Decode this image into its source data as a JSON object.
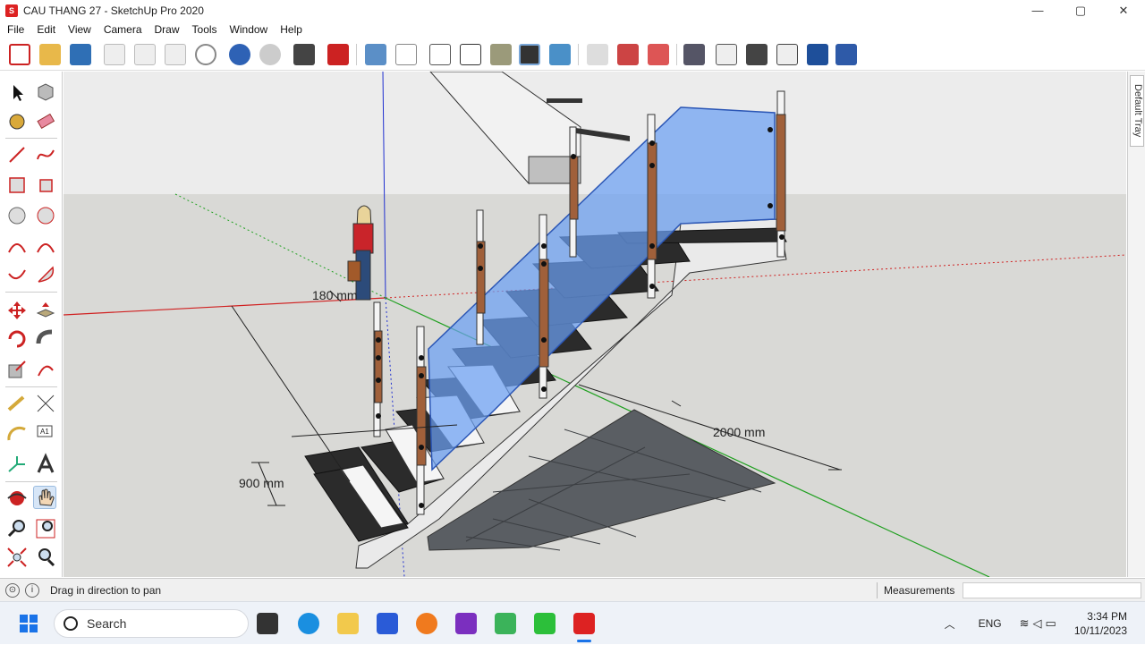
{
  "window": {
    "title": "CAU THANG 27 - SketchUp Pro 2020",
    "minimize": "—",
    "maximize": "▢",
    "close": "✕"
  },
  "menu": [
    "File",
    "Edit",
    "View",
    "Camera",
    "Draw",
    "Tools",
    "Window",
    "Help"
  ],
  "tray": {
    "label": "Default Tray"
  },
  "viewport": {
    "dimensions": {
      "width_label": "900 mm",
      "length_label": "2000 mm",
      "height_label": "180 mm"
    }
  },
  "status": {
    "message": "Drag in direction to pan",
    "measurements_label": "Measurements",
    "measurements_value": ""
  },
  "taskbar": {
    "search_label": "Search",
    "language": "ENG",
    "time": "3:34 PM",
    "date": "10/11/2023"
  },
  "colors": {
    "accent": "#1a73e8",
    "sketchup_red": "#d22222",
    "glass": "#6b9ff2",
    "wood": "#a0603a"
  }
}
